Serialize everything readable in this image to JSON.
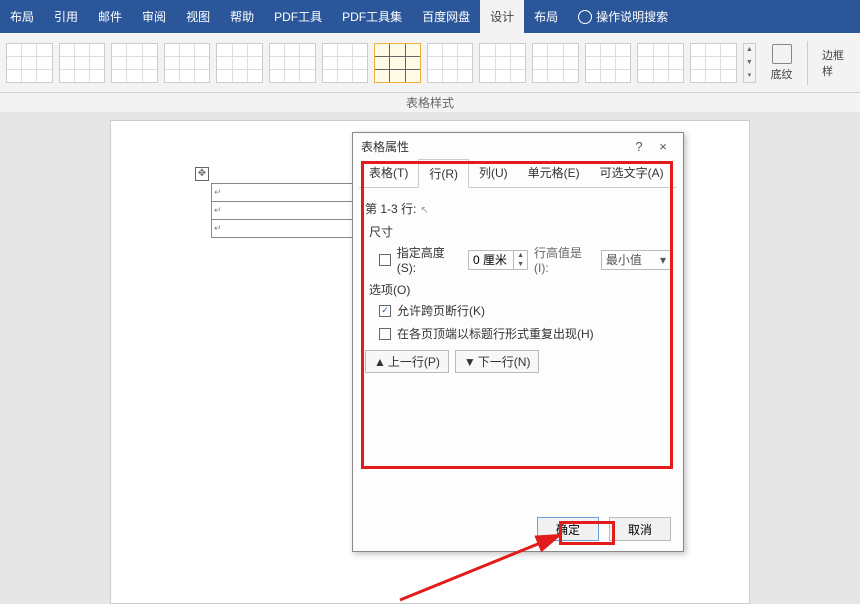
{
  "ribbon": {
    "tabs": [
      "布局",
      "引用",
      "邮件",
      "审阅",
      "视图",
      "帮助",
      "PDF工具",
      "PDF工具集",
      "百度网盘",
      "设计",
      "布局"
    ],
    "active_index": 9,
    "tell_me": "操作说明搜索"
  },
  "gallery": {
    "group_label": "表格样式",
    "shading_label": "底纹",
    "border_label": "边框样"
  },
  "dialog": {
    "title": "表格属性",
    "help": "?",
    "close": "×",
    "tabs": {
      "table": "表格(T)",
      "row": "行(R)",
      "column": "列(U)",
      "cell": "单元格(E)",
      "alt": "可选文字(A)"
    },
    "active_tab": "row",
    "rows_label": "第 1-3 行:",
    "size_label": "尺寸",
    "specify_height_label": "指定高度(S):",
    "height_value": "0 厘米",
    "row_height_is_label": "行高值是(I):",
    "row_height_mode": "最小值",
    "options_label": "选项(O)",
    "allow_break_label": "允许跨页断行(K)",
    "allow_break_checked": true,
    "repeat_header_label": "在各页顶端以标题行形式重复出现(H)",
    "repeat_header_checked": false,
    "prev_row": "上一行(P)",
    "next_row": "下一行(N)",
    "ok": "确定",
    "cancel": "取消"
  }
}
